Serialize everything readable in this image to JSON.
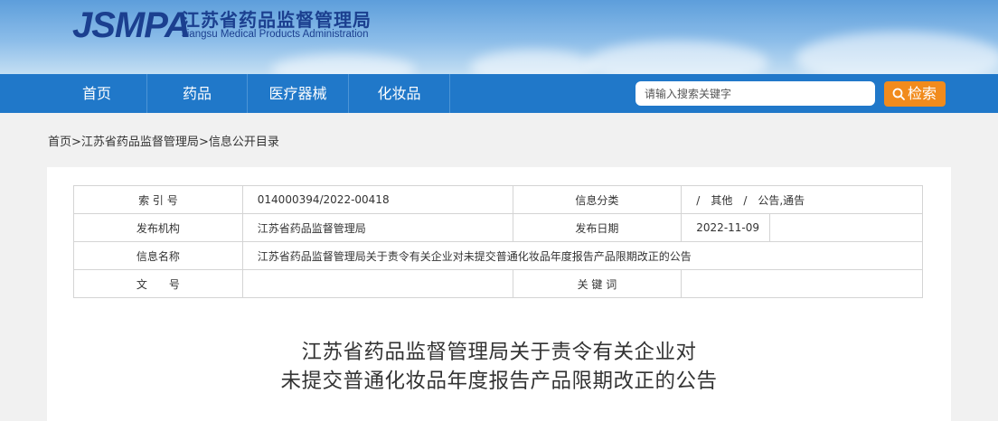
{
  "header": {
    "logo_abbr": "JSMPA",
    "logo_cn": "江苏省药品监督管理局",
    "logo_en": "Jiangsu Medical Products Administration"
  },
  "nav": {
    "items": [
      "首页",
      "药品",
      "医疗器械",
      "化妆品"
    ],
    "search_placeholder": "请输入搜索关键字",
    "search_button": "检索",
    "search_icon": "search-icon"
  },
  "breadcrumb": {
    "items": [
      "首页",
      "江苏省药品监督管理局",
      "信息公开目录"
    ],
    "separator": ">"
  },
  "meta": {
    "index_label": "索 引 号",
    "index_value": "014000394/2022-00418",
    "category_label": "信息分类",
    "category_value": "/　其他　/　公告,通告",
    "publisher_label": "发布机构",
    "publisher_value": "江苏省药品监督管理局",
    "date_label": "发布日期",
    "date_value": "2022-11-09",
    "name_label": "信息名称",
    "name_value": "江苏省药品监督管理局关于责令有关企业对未提交普通化妆品年度报告产品限期改正的公告",
    "doc_label": "文　　号",
    "doc_value": "",
    "keyword_label": "关 键 词",
    "keyword_value": ""
  },
  "article": {
    "title_line1": "江苏省药品监督管理局关于责令有关企业对",
    "title_line2": "未提交普通化妆品年度报告产品限期改正的公告"
  },
  "colors": {
    "nav_bg": "#2078c9",
    "logo": "#1b3f8f",
    "search_button": "#f18b1c"
  }
}
